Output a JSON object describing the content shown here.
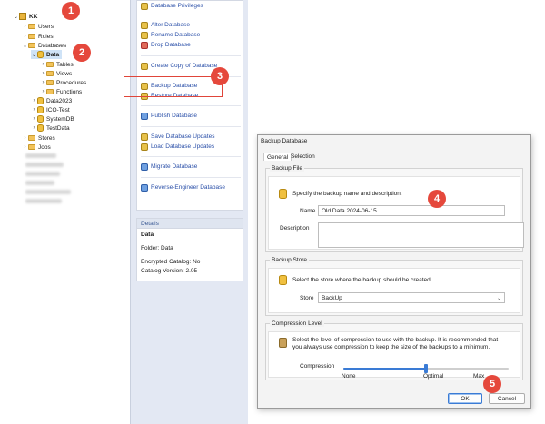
{
  "tree": {
    "server": "KK",
    "items": [
      {
        "label": "Users"
      },
      {
        "label": "Roles"
      },
      {
        "label": "Databases"
      },
      {
        "label": "Data"
      },
      {
        "label": "Tables"
      },
      {
        "label": "Views"
      },
      {
        "label": "Procedures"
      },
      {
        "label": "Functions"
      },
      {
        "label": "Data2023"
      },
      {
        "label": "ICO-Test"
      },
      {
        "label": "SystemDB"
      },
      {
        "label": "TestData"
      },
      {
        "label": "Stores"
      },
      {
        "label": "Jobs"
      }
    ]
  },
  "actions": {
    "items": [
      {
        "label": "Database Privileges"
      },
      {
        "label": "Alter Database"
      },
      {
        "label": "Rename Database"
      },
      {
        "label": "Drop Database"
      },
      {
        "label": "Create Copy of Database"
      },
      {
        "label": "Backup Database"
      },
      {
        "label": "Restore Database"
      },
      {
        "label": "Publish Database"
      },
      {
        "label": "Save Database Updates"
      },
      {
        "label": "Load Database Updates"
      },
      {
        "label": "Migrate Database"
      },
      {
        "label": "Reverse-Engineer Database"
      }
    ]
  },
  "details": {
    "header": "Details",
    "title": "Data",
    "folder": "Folder: Data",
    "encrypted": "Encrypted Catalog: No",
    "version": "Catalog Version: 2.05"
  },
  "markers": [
    "1",
    "2",
    "3",
    "4",
    "5"
  ],
  "dialog": {
    "title": "Backup Database",
    "tabs": {
      "general": "General",
      "selection": "Selection"
    },
    "backup_file": {
      "header": "Backup File",
      "intro": "Specify the backup name and description.",
      "name_label": "Name",
      "name_value": "Old Data 2024-06-15",
      "description_label": "Description",
      "description_value": ""
    },
    "backup_store": {
      "header": "Backup Store",
      "intro": "Select the store where the backup should be created.",
      "store_label": "Store",
      "store_value": "BackUp"
    },
    "compression": {
      "header": "Compression Level",
      "intro_line1": "Select the level of compression to use with the backup.  It is recommended that",
      "intro_line2": "you always use compression to keep the size of the backups to a minimum.",
      "label": "Compression",
      "min_label": "None",
      "mid_label": "Optimal",
      "max_label": "Max",
      "level_fraction": 0.5
    },
    "ok_label": "OK",
    "cancel_label": "Cancel"
  },
  "colors": {
    "accent": "#3a7bd5",
    "marker": "#e5483c",
    "link": "#2a4fa8"
  }
}
